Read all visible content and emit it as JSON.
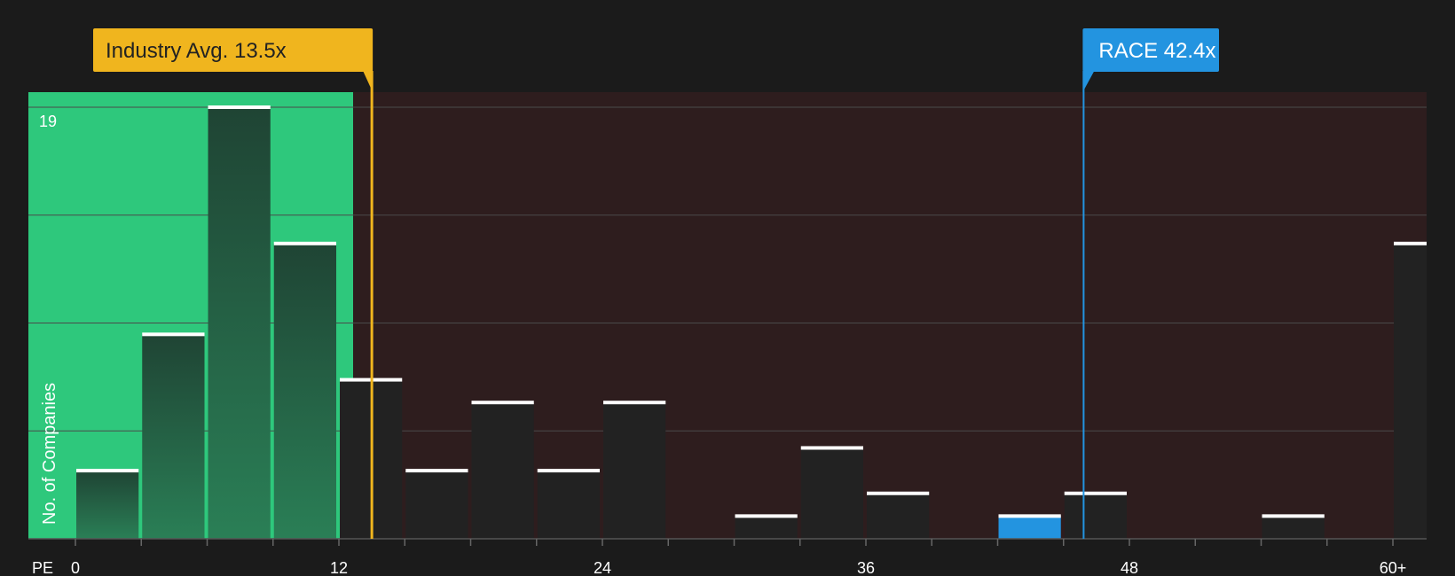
{
  "chart_data": {
    "type": "bar",
    "x_axis_label": "PE",
    "ylabel": "No. of Companies",
    "y_max_label": "19",
    "ylim": [
      0,
      19
    ],
    "x_ticks": [
      {
        "value": 0,
        "label": "0"
      },
      {
        "value": 12,
        "label": "12"
      },
      {
        "value": 24,
        "label": "24"
      },
      {
        "value": 36,
        "label": "36"
      },
      {
        "value": 48,
        "label": "48"
      },
      {
        "value": 60,
        "label": "60+"
      }
    ],
    "bin_width": 3,
    "bins": [
      {
        "start": 0,
        "value": 3
      },
      {
        "start": 3,
        "value": 9
      },
      {
        "start": 6,
        "value": 19
      },
      {
        "start": 9,
        "value": 13
      },
      {
        "start": 12,
        "value": 7
      },
      {
        "start": 15,
        "value": 3
      },
      {
        "start": 18,
        "value": 6
      },
      {
        "start": 21,
        "value": 3
      },
      {
        "start": 24,
        "value": 6
      },
      {
        "start": 27,
        "value": 0
      },
      {
        "start": 30,
        "value": 1
      },
      {
        "start": 33,
        "value": 4
      },
      {
        "start": 36,
        "value": 2
      },
      {
        "start": 39,
        "value": 0
      },
      {
        "start": 42,
        "value": 1,
        "highlight": true
      },
      {
        "start": 45,
        "value": 2
      },
      {
        "start": 48,
        "value": 0
      },
      {
        "start": 51,
        "value": 0
      },
      {
        "start": 54,
        "value": 1
      },
      {
        "start": 57,
        "value": 0
      },
      {
        "start": 60,
        "value": 13
      }
    ],
    "industry_avg": {
      "value": 13.5,
      "label": "Industry Avg. 13.5x",
      "color": "#f0b51e"
    },
    "company": {
      "value": 42.4,
      "label": "RACE 42.4x",
      "color": "#2394e0"
    },
    "colors": {
      "background": "#1b1b1b",
      "below_avg_region": "#2ec87c",
      "above_avg_region": "#2e1d1e",
      "bar_dark": "#222222",
      "bar_cap": "#ffffff",
      "gridline": "#4a4a4a"
    }
  }
}
